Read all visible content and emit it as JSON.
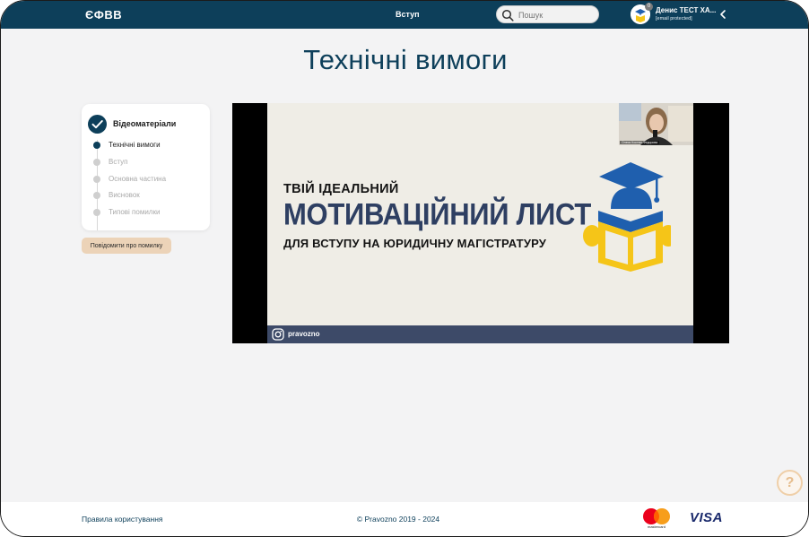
{
  "header": {
    "logo": "ЄФВВ",
    "nav_link": "Вступ",
    "search_placeholder": "Пошук",
    "user_name": "Денис ТЕСТ ХА...",
    "user_email": "[email protected]",
    "notification_count": "0"
  },
  "page": {
    "title": "Технічні вимоги"
  },
  "sidebar": {
    "section_title": "Відеоматеріали",
    "steps": [
      {
        "label": "Технічні вимоги",
        "active": true
      },
      {
        "label": "Вступ",
        "active": false
      },
      {
        "label": "Основна частина",
        "active": false
      },
      {
        "label": "Висновок",
        "active": false
      },
      {
        "label": "Типові помилки",
        "active": false
      }
    ],
    "report_button": "Повідомити про помилку"
  },
  "video": {
    "slide_line1": "ТВІЙ ІДЕАЛЬНИЙ",
    "slide_line2": "МОТИВАЦІЙНИЙ ЛИСТ",
    "slide_line3": "ДЛЯ ВСТУПУ НА ЮРИДИЧНУ МАГІСТРАТУРУ",
    "instagram_handle": "pravozno",
    "webcam_label": "Олеся Костюк-Федорова"
  },
  "help": {
    "label": "?"
  },
  "footer": {
    "terms_link": "Правила користування",
    "copyright": "© Pravozno 2019 - 2024",
    "mastercard_text": "mastercard",
    "visa_text": "VISA"
  },
  "colors": {
    "primary": "#0d3f5a",
    "accent": "#ecd3b8",
    "slide_navy": "#2e3f62",
    "slide_yellow": "#f5c518",
    "slide_blue": "#1f5fae"
  }
}
